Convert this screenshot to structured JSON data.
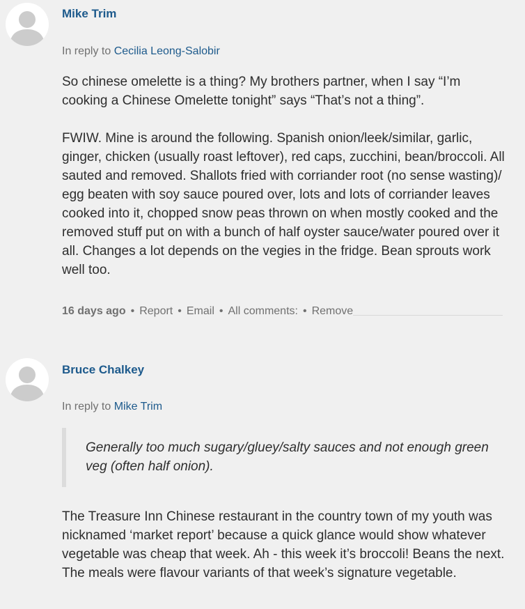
{
  "comments": [
    {
      "author": "Mike Trim",
      "reply_prefix": "In reply to",
      "reply_to": "Cecilia Leong-Salobir",
      "paragraphs": [
        "So chinese omelette is a thing?  My brothers partner, when I say “I’m cooking a Chinese Omelette tonight” says “That’s not a thing”.",
        "FWIW.  Mine is around the following.  Spanish onion/leek/similar, garlic, ginger, chicken (usually roast leftover), red caps, zucchini, bean/broccoli.  All sauted and removed.  Shallots fried with corriander root (no sense wasting)/ egg beaten with soy sauce poured over, lots and lots of corriander leaves cooked into it, chopped snow peas thrown on when mostly cooked and the removed stuff put on with a bunch of half oyster sauce/water poured over it all.  Changes a lot depends on the vegies in the fridge.  Bean sprouts work well too."
      ],
      "time_ago": "16 days ago",
      "actions": {
        "report": "Report",
        "email": "Email",
        "all_comments": "All comments:",
        "remove": "Remove"
      },
      "separator": "•"
    },
    {
      "author": "Bruce Chalkey",
      "reply_prefix": "In reply to",
      "reply_to": "Mike Trim",
      "quote": "Generally too much sugary/gluey/salty sauces and not enough green veg (often half onion).",
      "paragraphs": [
        "The Treasure Inn Chinese restaurant in the country town of  my youth was nicknamed ‘market report’ because a quick glance would show whatever vegetable was cheap that week.  Ah - this week it’s broccoli! Beans the next. The meals were flavour variants of that week’s signature vegetable."
      ]
    }
  ],
  "colors": {
    "background": "#f0f0f0",
    "link": "#1d5a8c",
    "text": "#2e2e2e",
    "muted": "#707070",
    "avatar_silhouette": "#cccccc"
  },
  "icons": {
    "avatar": "default-user-avatar-icon"
  }
}
